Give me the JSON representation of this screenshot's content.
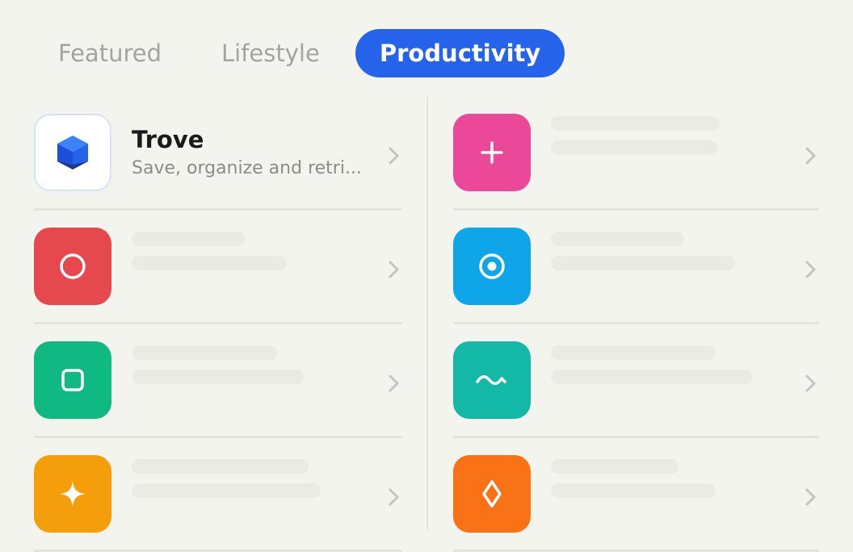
{
  "tabs": [
    {
      "label": "Featured",
      "active": false
    },
    {
      "label": "Lifestyle",
      "active": false
    },
    {
      "label": "Productivity",
      "active": true
    }
  ],
  "featured_app": {
    "name": "Trove",
    "description": "Save, organize and retri...",
    "icon": "cube-icon"
  },
  "colors": {
    "accent": "#2563eb",
    "red": "#e5484d",
    "green": "#10b981",
    "amber": "#f59e0b",
    "pink": "#ec4899",
    "sky": "#0ea5e9",
    "teal": "#14b8a6",
    "orange": "#f97316"
  },
  "apps": {
    "left": [
      {
        "icon": "circle-icon",
        "color": "#e5484d"
      },
      {
        "icon": "square-icon",
        "color": "#10b981"
      },
      {
        "icon": "sparkle-icon",
        "color": "#f59e0b"
      }
    ],
    "right": [
      {
        "icon": "plus-icon",
        "color": "#ec4899"
      },
      {
        "icon": "target-icon",
        "color": "#0ea5e9"
      },
      {
        "icon": "wave-icon",
        "color": "#14b8a6"
      },
      {
        "icon": "diamond-icon",
        "color": "#f97316"
      }
    ]
  }
}
